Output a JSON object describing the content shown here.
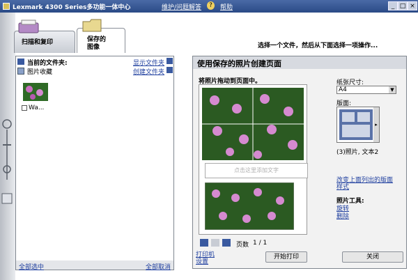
{
  "window": {
    "title": "Lexmark 4300 Series多功能一体中心",
    "help_links": [
      "维护/问题解答",
      "帮助"
    ],
    "controls": [
      "_",
      "□",
      "×"
    ]
  },
  "tabs": [
    {
      "label": "扫描和复印",
      "active": false
    },
    {
      "label_line1": "保存的",
      "label_line2": "图像",
      "active": true
    }
  ],
  "instruction": "选择一个文件，然后从下面选择一项操作...",
  "left": {
    "current_folder_label": "当前的文件夹:",
    "folder_name": "图片收藏",
    "show_folder": "显示文件夹",
    "create_folder": "创建文件夹",
    "thumbnail_caption": "Wa...",
    "select_all": "全部选中",
    "deselect_all": "全部取消"
  },
  "right": {
    "panel_title": "使用保存的照片创建页面",
    "drag_hint": "将照片拖动到页面中。",
    "text_hint": "点击这里添加文字",
    "paper_size_label": "纸张尺寸:",
    "paper_size_value": "A4",
    "layout_label": "版面:",
    "layout_desc": "(3)照片, 文本2",
    "change_layout_link": "改变上面列出的版面",
    "change_layout_link2": "样式",
    "photo_tools_label": "照片工具:",
    "rotate": "旋转",
    "delete": "删除",
    "page_label": "页数",
    "page_value": "1 / 1",
    "printer_settings_line1": "打印机",
    "printer_settings_line2": "设置",
    "start_print": "开始打印",
    "close": "关闭"
  },
  "colors": {
    "titlebar": "#2a4a86",
    "link": "#1f3f9f",
    "leaf_green": "#3e7a2a",
    "lotus_pink": "#d88ad0"
  }
}
